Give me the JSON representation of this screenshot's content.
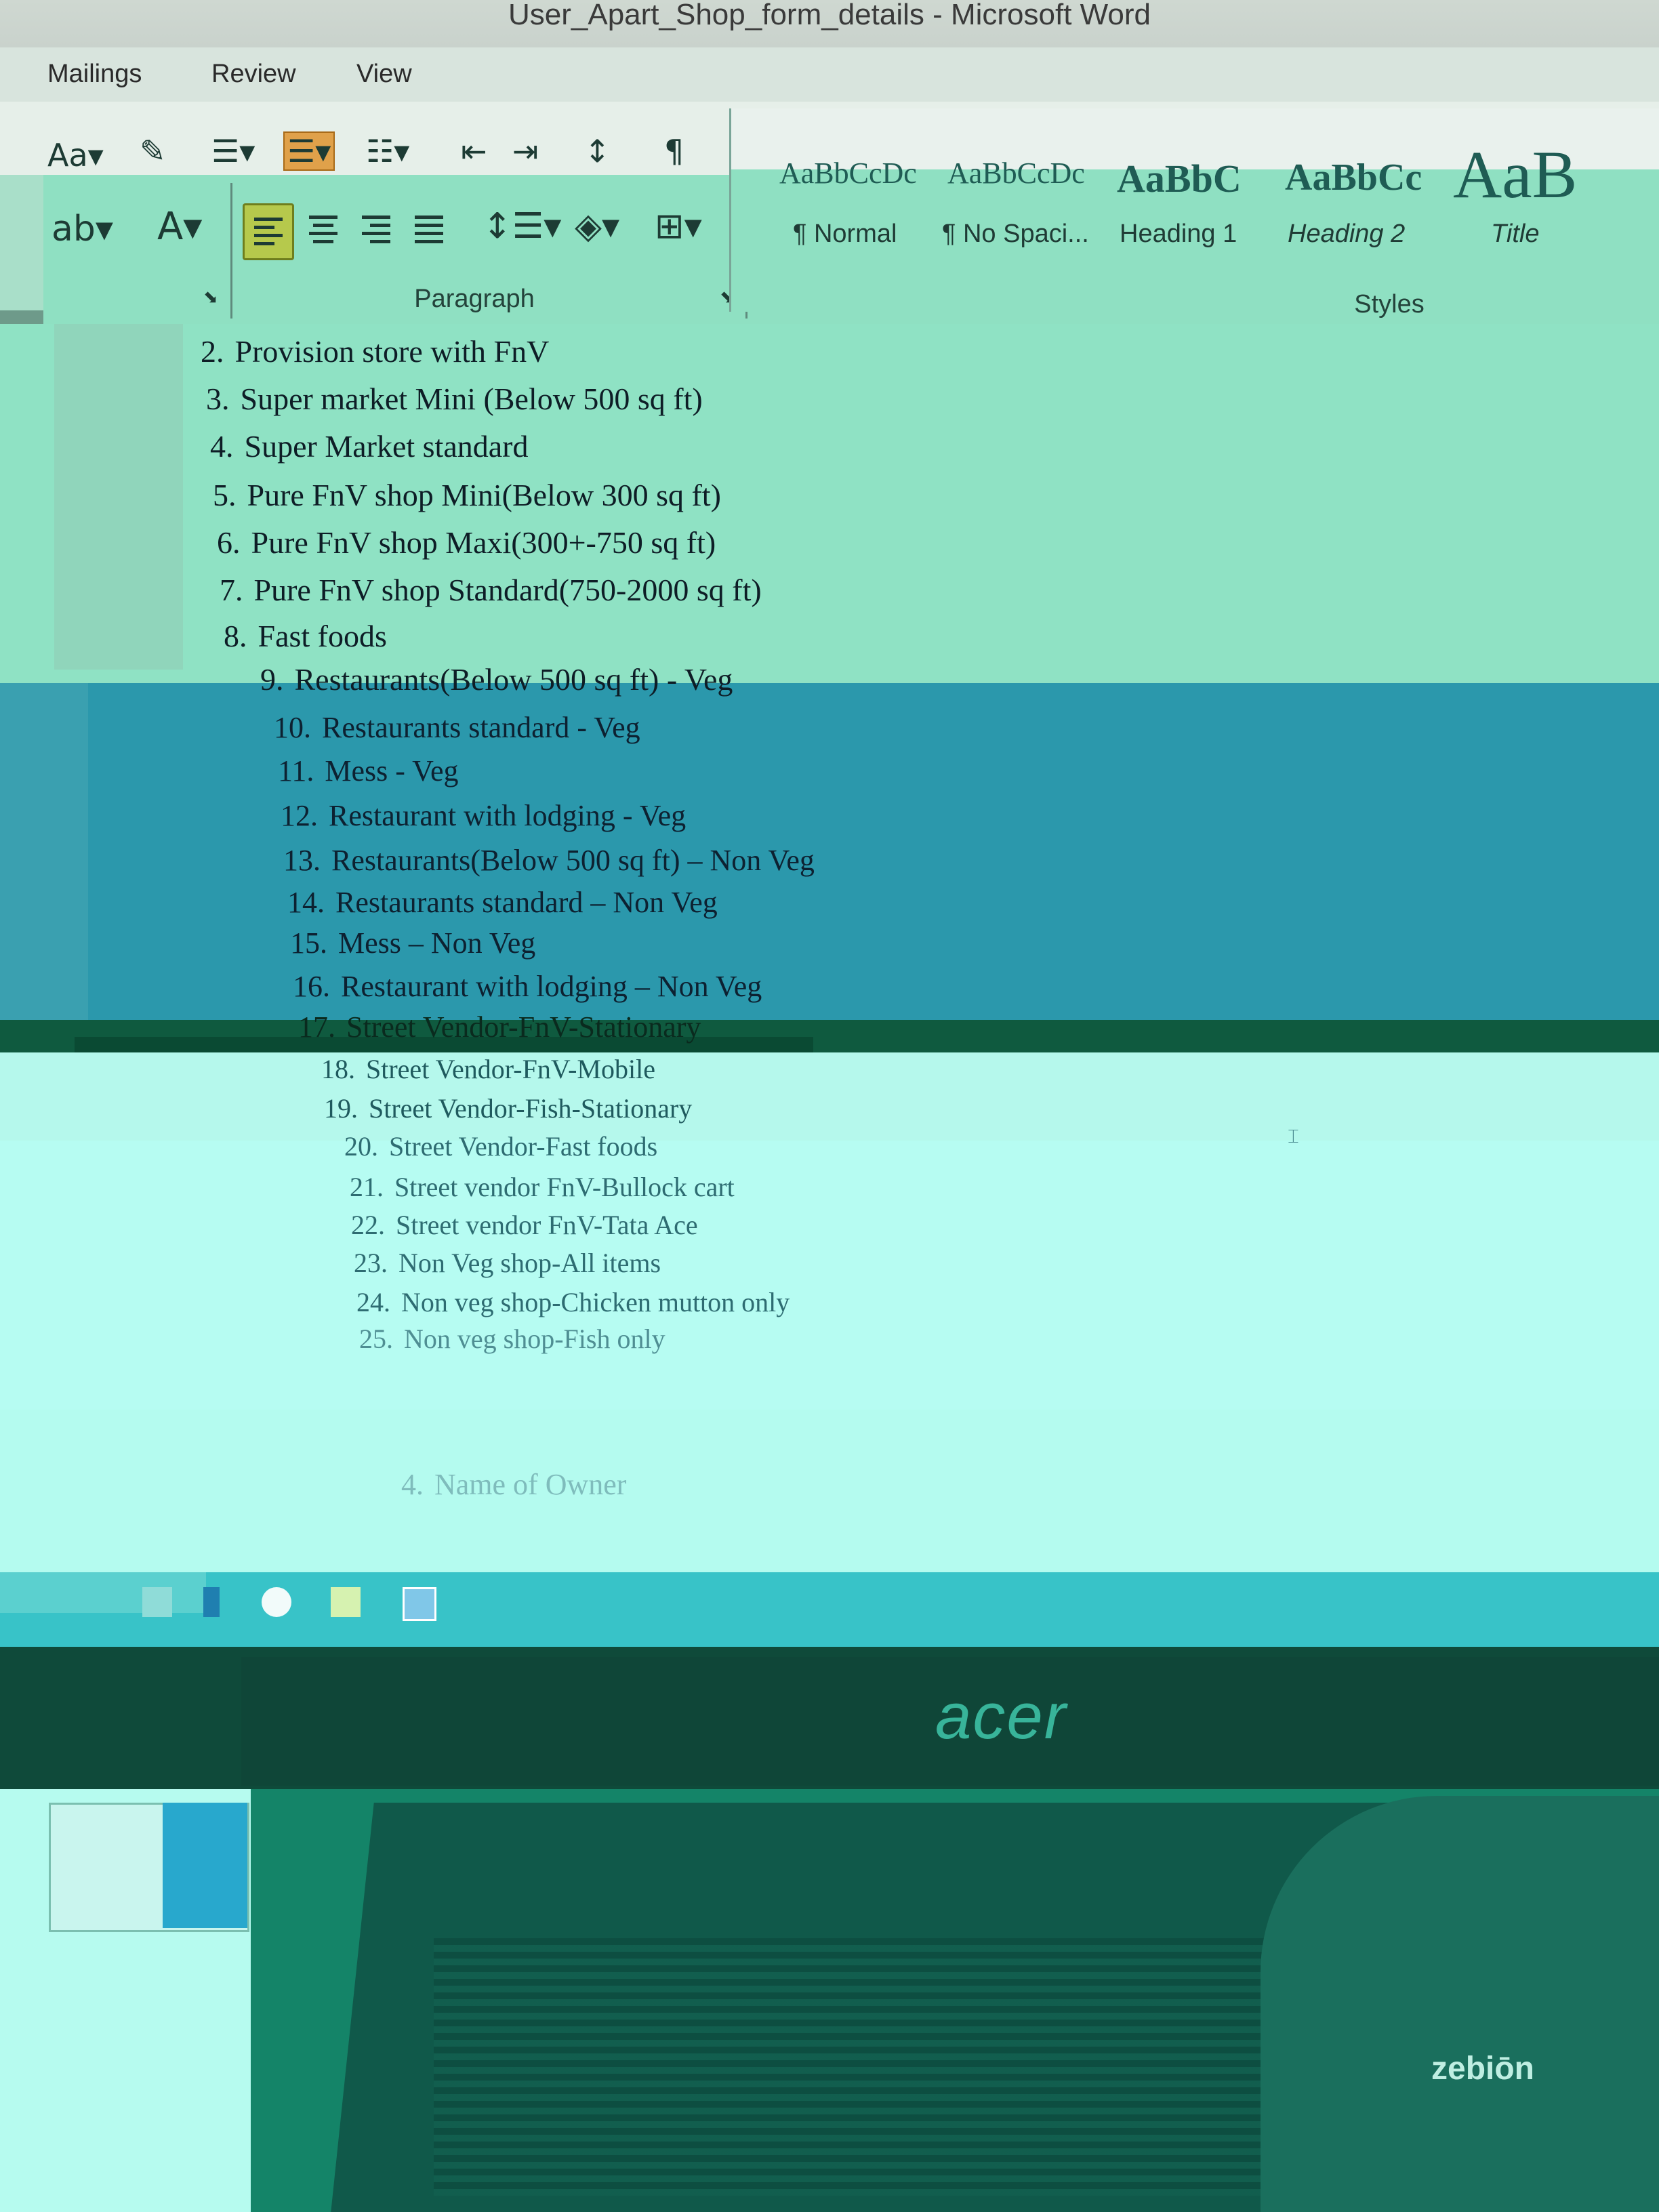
{
  "window": {
    "title": "User_Apart_Shop_form_details - Microsoft Word"
  },
  "menu": {
    "items": [
      "Mailings",
      "Review",
      "View"
    ]
  },
  "ribbon": {
    "paragraph_group_label": "Paragraph",
    "styles_group_label": "Styles",
    "styles": [
      {
        "preview": "AaBbCcDc",
        "name": "¶ Normal"
      },
      {
        "preview": "AaBbCcDc",
        "name": "¶ No Spaci..."
      },
      {
        "preview": "AaBbC",
        "name": "Heading 1"
      },
      {
        "preview": "AaBbCc",
        "name": "Heading 2"
      },
      {
        "preview": "AaB",
        "name": "Title"
      }
    ],
    "active_button": "align-left",
    "icons": [
      "text-highlight-icon",
      "font-color-icon",
      "align-left-icon",
      "align-center-icon",
      "align-right-icon",
      "justify-icon",
      "line-spacing-icon",
      "shading-icon",
      "borders-icon"
    ]
  },
  "document": {
    "list_items": [
      {
        "num": "2.",
        "text": "Provision store with FnV"
      },
      {
        "num": "3.",
        "text": "Super market Mini (Below 500 sq ft)"
      },
      {
        "num": "4.",
        "text": "Super Market standard"
      },
      {
        "num": "5.",
        "text": "Pure FnV shop Mini(Below 300 sq ft)"
      },
      {
        "num": "6.",
        "text": "Pure FnV shop Maxi(300+-750 sq ft)"
      },
      {
        "num": "7.",
        "text": "Pure FnV shop Standard(750-2000 sq ft)"
      },
      {
        "num": "8.",
        "text": "Fast foods"
      },
      {
        "num": "9.",
        "text": "Restaurants(Below 500 sq ft) - Veg"
      },
      {
        "num": "10.",
        "text": "Restaurants standard - Veg"
      },
      {
        "num": "11.",
        "text": "Mess - Veg"
      },
      {
        "num": "12.",
        "text": "Restaurant with lodging - Veg"
      },
      {
        "num": "13.",
        "text": "Restaurants(Below 500 sq ft) – Non Veg"
      },
      {
        "num": "14.",
        "text": "Restaurants standard – Non Veg"
      },
      {
        "num": "15.",
        "text": "Mess – Non Veg"
      },
      {
        "num": "16.",
        "text": "Restaurant with lodging – Non Veg"
      },
      {
        "num": "17.",
        "text": "Street Vendor-FnV-Stationary"
      },
      {
        "num": "18.",
        "text": "Street Vendor-FnV-Mobile"
      },
      {
        "num": "19.",
        "text": "Street Vendor-Fish-Stationary"
      },
      {
        "num": "20.",
        "text": "Street Vendor-Fast foods"
      },
      {
        "num": "21.",
        "text": "Street vendor FnV-Bullock cart"
      },
      {
        "num": "22.",
        "text": "Street vendor FnV-Tata Ace"
      },
      {
        "num": "23.",
        "text": "Non Veg shop-All items"
      },
      {
        "num": "24.",
        "text": "Non veg shop-Chicken mutton only"
      },
      {
        "num": "25.",
        "text": "Non veg shop-Fish only"
      }
    ],
    "section_heading": {
      "num": "4.",
      "text": "Name of Owner"
    }
  },
  "hardware": {
    "monitor_brand": "acer",
    "mouse_brand": "zebiōn"
  }
}
